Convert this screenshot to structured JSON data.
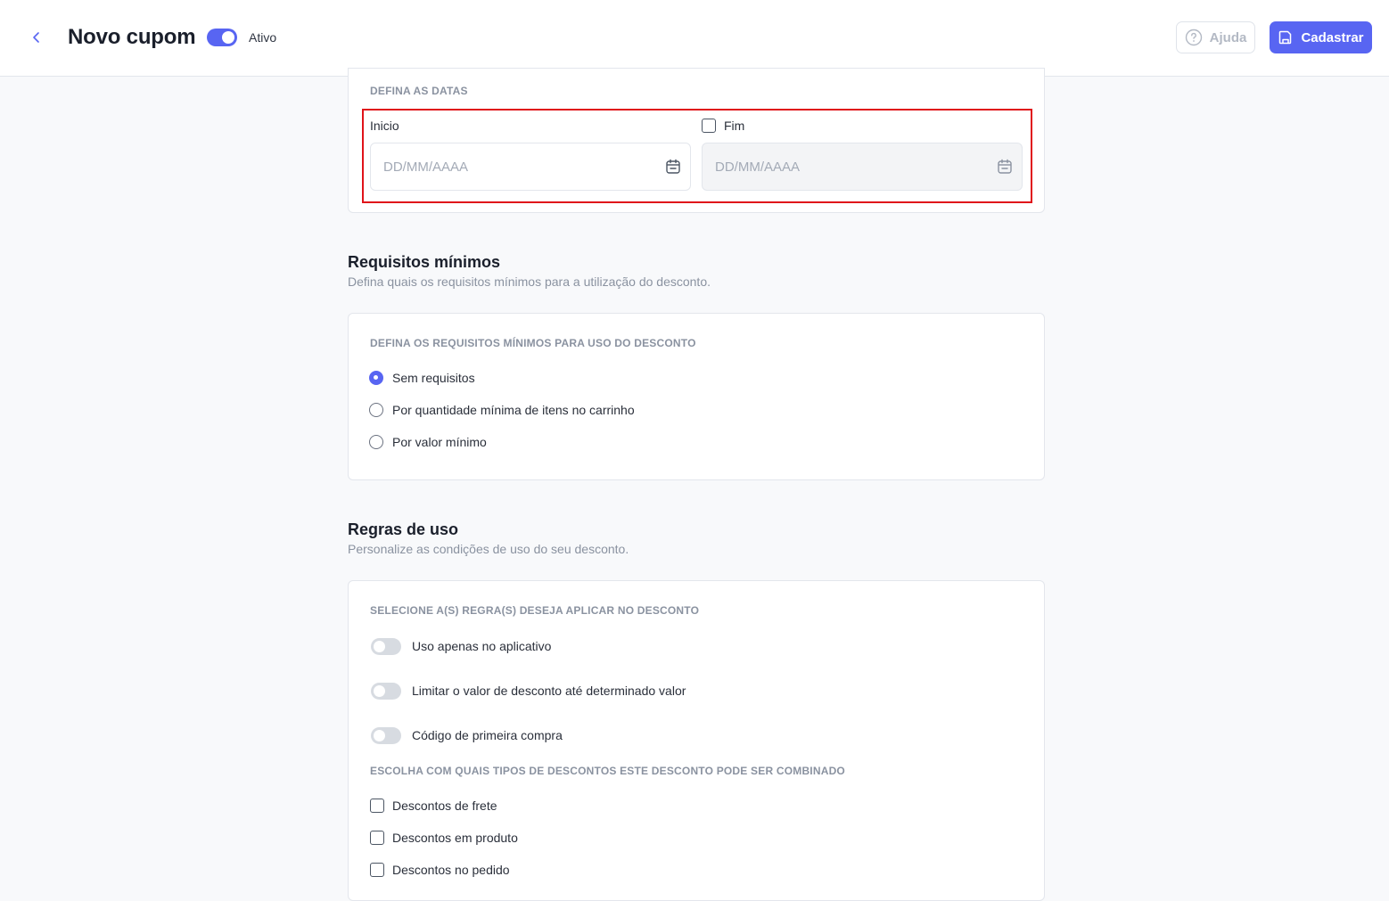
{
  "header": {
    "title": "Novo cupom",
    "active_label": "Ativo",
    "help_label": "Ajuda",
    "save_label": "Cadastrar"
  },
  "dates": {
    "overline": "DEFINA AS DATAS",
    "start_label": "Inicio",
    "start_placeholder": "DD/MM/AAAA",
    "end_label": "Fim",
    "end_placeholder": "DD/MM/AAAA"
  },
  "requirements": {
    "title": "Requisitos mínimos",
    "subtitle": "Defina quais os requisitos mínimos para a utilização do desconto.",
    "overline": "DEFINA OS REQUISITOS MÍNIMOS PARA USO DO DESCONTO",
    "options": [
      "Sem requisitos",
      "Por quantidade mínima de itens no carrinho",
      "Por valor mínimo"
    ],
    "selected": "Sem requisitos"
  },
  "rules": {
    "title": "Regras de uso",
    "subtitle": "Personalize as condições de uso do seu desconto.",
    "overline": "SELECIONE A(S) REGRA(S) DESEJA APLICAR NO DESCONTO",
    "toggles": [
      "Uso apenas no aplicativo",
      "Limitar o valor de desconto até determinado valor",
      "Código de primeira compra"
    ],
    "combine_overline": "ESCOLHA COM QUAIS TIPOS DE DESCONTOS ESTE DESCONTO PODE SER COMBINADO",
    "combine_options": [
      "Descontos de frete",
      "Descontos em produto",
      "Descontos no pedido"
    ]
  },
  "colors": {
    "accent": "#5865f2",
    "highlight": "#e0131a"
  }
}
